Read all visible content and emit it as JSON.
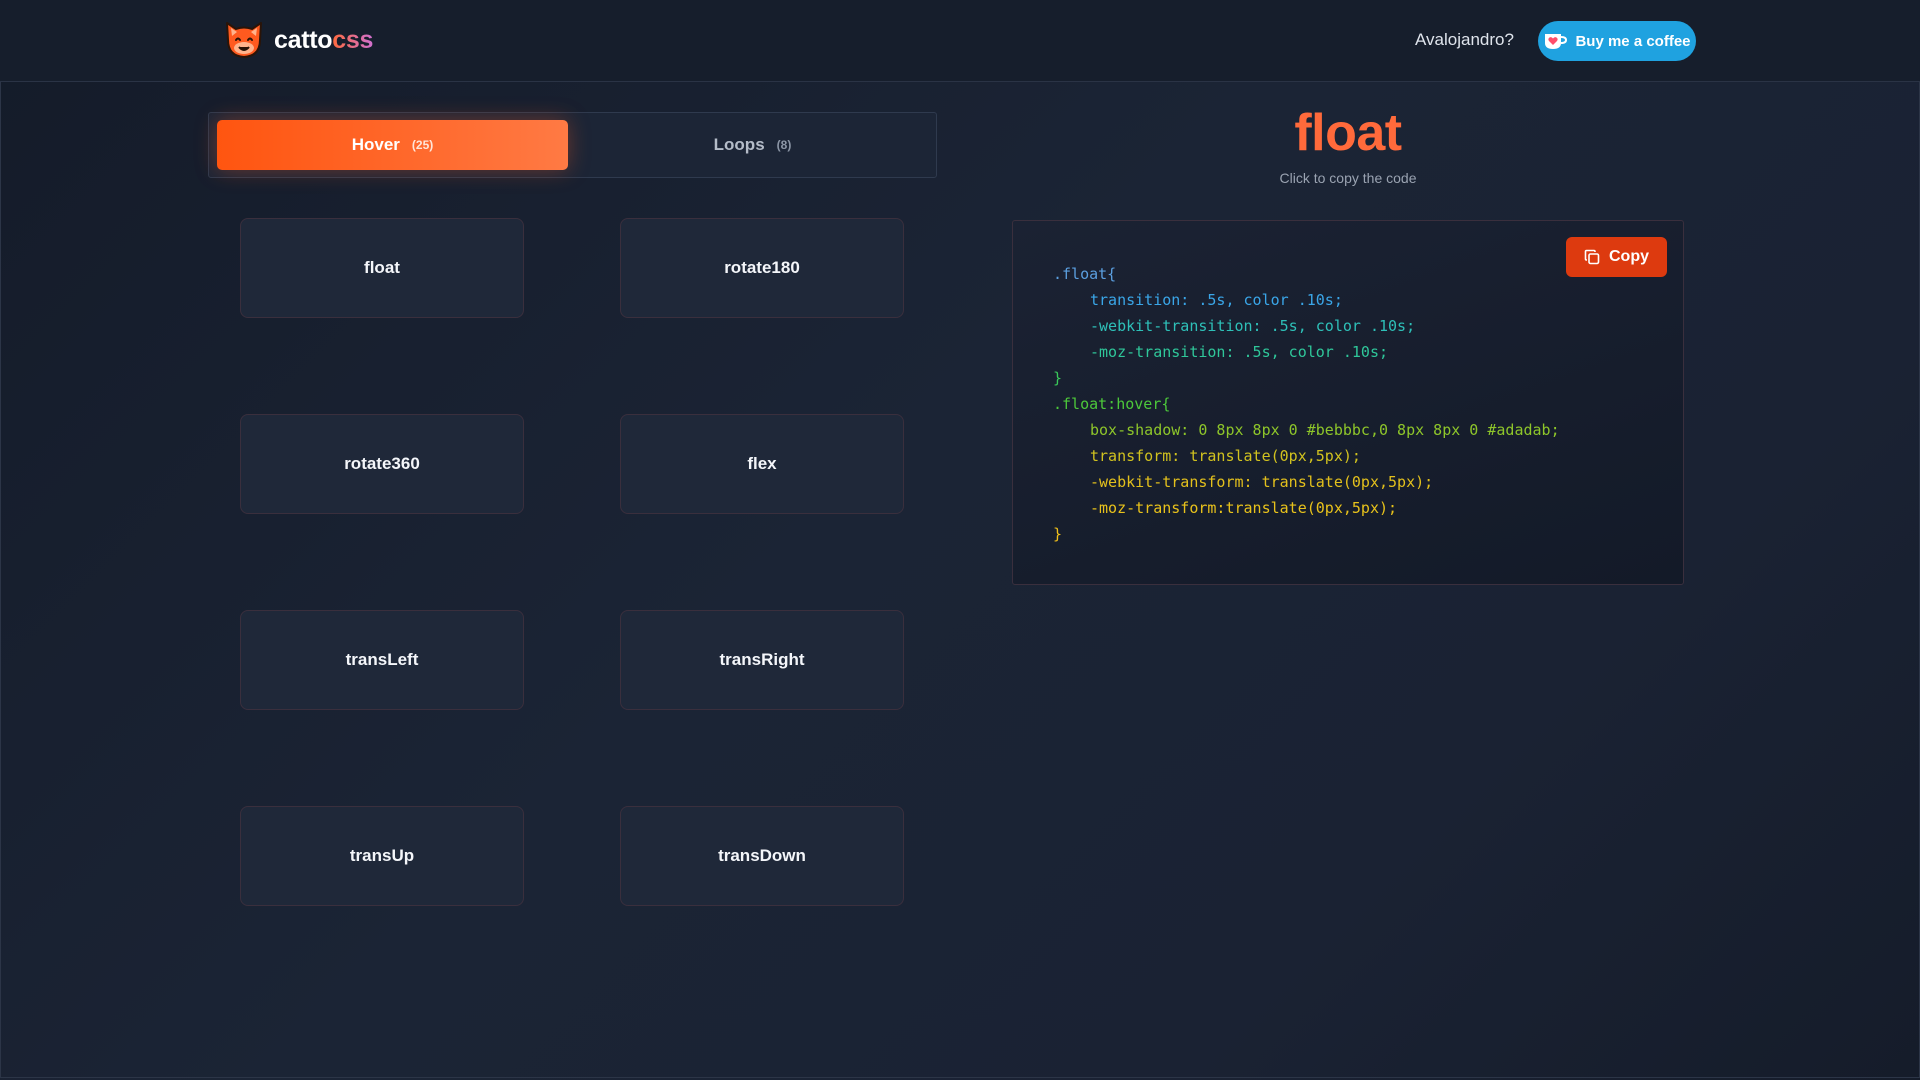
{
  "header": {
    "brand_part1": "catto",
    "brand_part2": "css",
    "logo_icon": "cat-face-icon",
    "author_link": "Avalojandro?",
    "coffee_label": "Buy me a coffee",
    "coffee_icon": "heart-cup-icon"
  },
  "tabs": [
    {
      "label": "Hover",
      "count": "(25)",
      "active": true
    },
    {
      "label": "Loops",
      "count": "(8)",
      "active": false
    }
  ],
  "effects": [
    "float",
    "rotate180",
    "rotate360",
    "flex",
    "transLeft",
    "transRight",
    "transUp",
    "transDown"
  ],
  "preview": {
    "title": "float",
    "subtitle": "Click to copy the code",
    "copy_label": "Copy",
    "copy_icon": "copy-icon",
    "code": [
      {
        "text": ".float{",
        "indent": false,
        "color": "#5b9fe0"
      },
      {
        "text": "transition: .5s, color .10s;",
        "indent": true,
        "color": "#3aa6e8"
      },
      {
        "text": "-webkit-transition: .5s, color .10s;",
        "indent": true,
        "color": "#2ec0b8"
      },
      {
        "text": "-moz-transition: .5s, color .10s;",
        "indent": true,
        "color": "#2fc79a"
      },
      {
        "text": "}",
        "indent": false,
        "color": "#3ac85a"
      },
      {
        "text": ".float:hover{",
        "indent": false,
        "color": "#4cc83a"
      },
      {
        "text": "box-shadow: 0 8px 8px 0 #bebbbc,0 8px 8px 0 #adadab;",
        "indent": true,
        "color": "#8ec62a"
      },
      {
        "text": "transform: translate(0px,5px);",
        "indent": true,
        "color": "#d1c21f"
      },
      {
        "text": "-webkit-transform: translate(0px,5px);",
        "indent": true,
        "color": "#e3c01c"
      },
      {
        "text": "-moz-transform:translate(0px,5px);",
        "indent": true,
        "color": "#e8c21b"
      },
      {
        "text": "}",
        "indent": false,
        "color": "#f0c01a"
      }
    ]
  },
  "colors": {
    "accent": "#ff5a1f",
    "title": "#ff6a3b",
    "coffee": "#1fa2e0",
    "copy_button": "#dd3a0f"
  }
}
